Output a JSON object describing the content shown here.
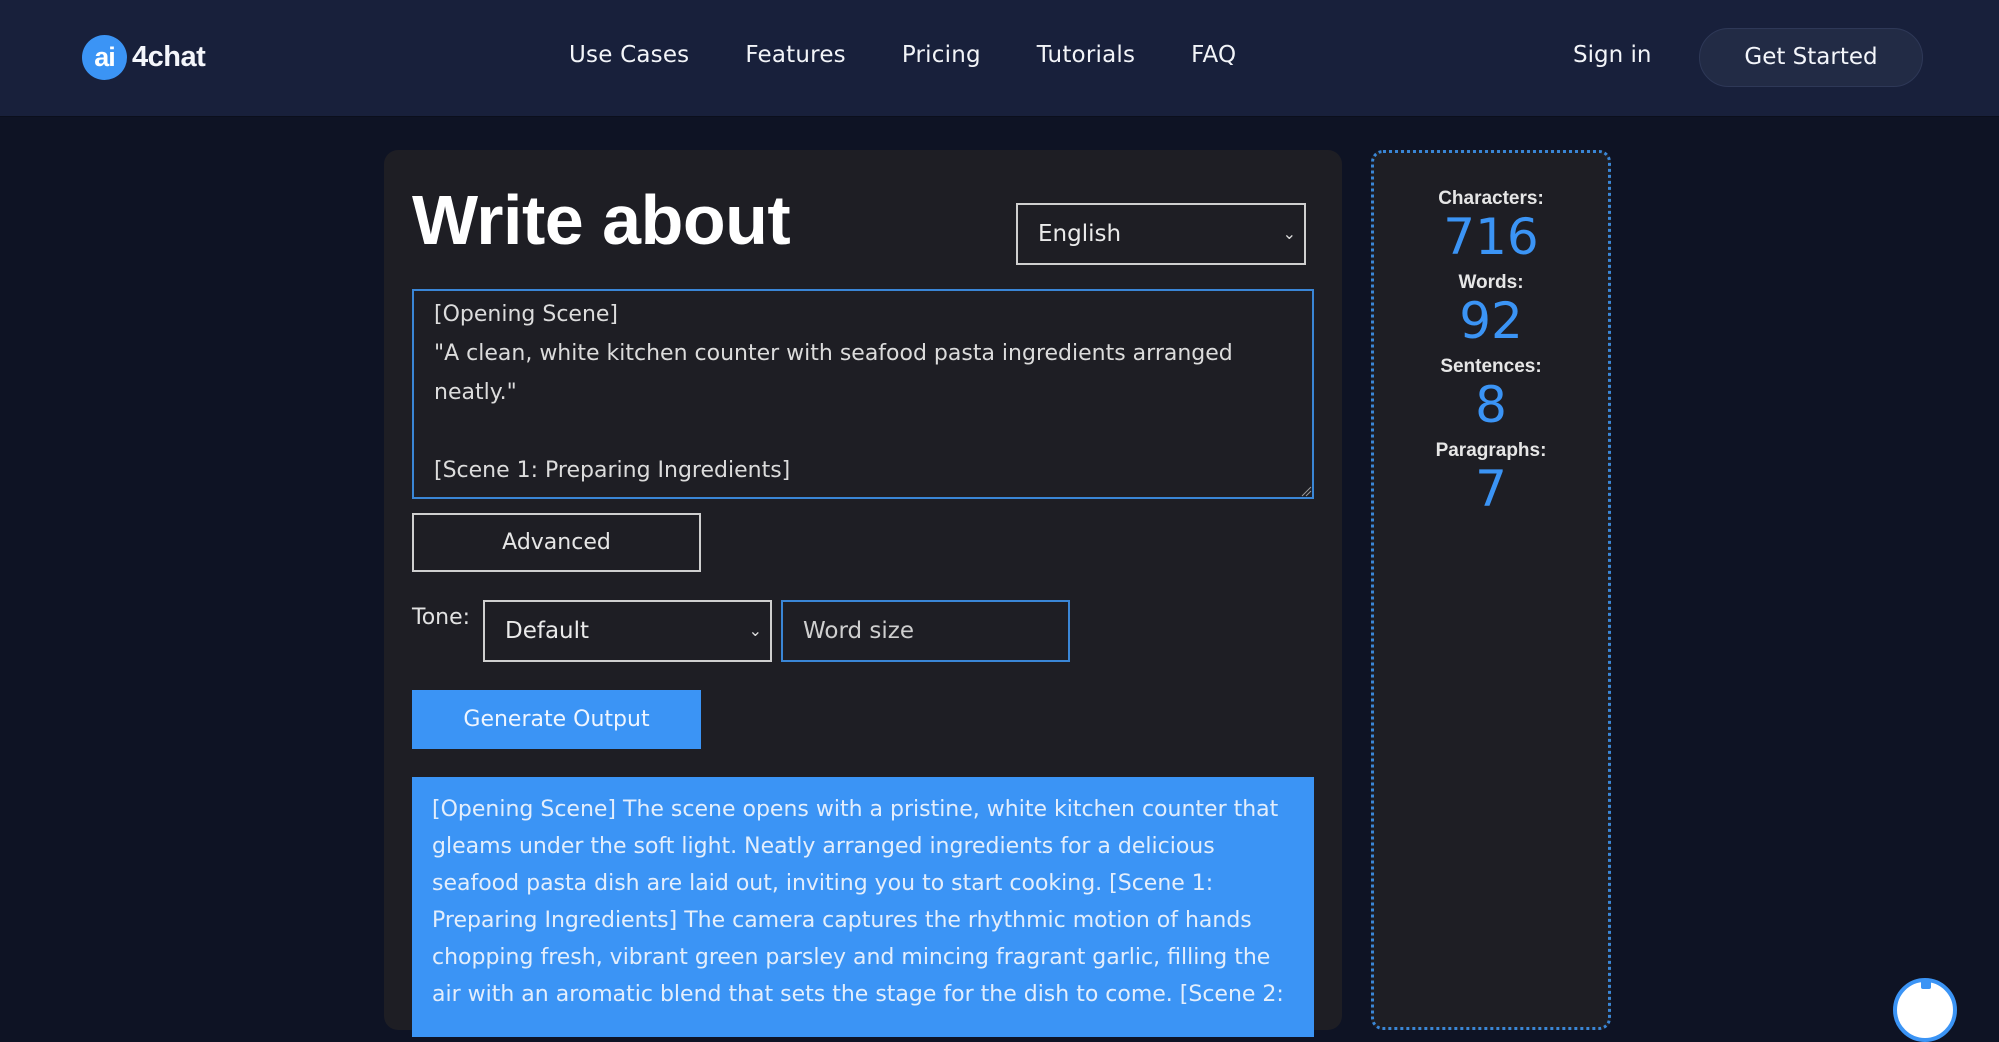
{
  "header": {
    "logo": {
      "badge": "ai",
      "text": "4chat"
    },
    "nav": [
      "Use Cases",
      "Features",
      "Pricing",
      "Tutorials",
      "FAQ"
    ],
    "sign_in": "Sign in",
    "get_started": "Get Started"
  },
  "main": {
    "title": "Write about",
    "language": {
      "selected": "English"
    },
    "prompt": "[Opening Scene]\n\"A clean, white kitchen counter with seafood pasta ingredients arranged neatly.\"\n\n[Scene 1: Preparing Ingredients]",
    "advanced_label": "Advanced",
    "tone": {
      "label": "Tone:",
      "selected": "Default"
    },
    "word_size": {
      "placeholder": "Word size",
      "value": ""
    },
    "generate_label": "Generate Output",
    "output": "[Opening Scene] The scene opens with a pristine, white kitchen counter that gleams under the soft light. Neatly arranged ingredients for a delicious seafood pasta dish are laid out, inviting you to start cooking. [Scene 1: Preparing Ingredients] The camera captures the rhythmic motion of hands chopping fresh, vibrant green parsley and mincing fragrant garlic, filling the air with an aromatic blend that sets the stage for the dish to come. [Scene 2:"
  },
  "stats": {
    "characters": {
      "label": "Characters:",
      "value": "716"
    },
    "words": {
      "label": "Words:",
      "value": "92"
    },
    "sentences": {
      "label": "Sentences:",
      "value": "8"
    },
    "paragraphs": {
      "label": "Paragraphs:",
      "value": "7"
    }
  },
  "colors": {
    "accent": "#3b94f5",
    "header_bg": "#18203b",
    "page_bg": "#0e1324",
    "card_bg": "#1e1e24"
  }
}
